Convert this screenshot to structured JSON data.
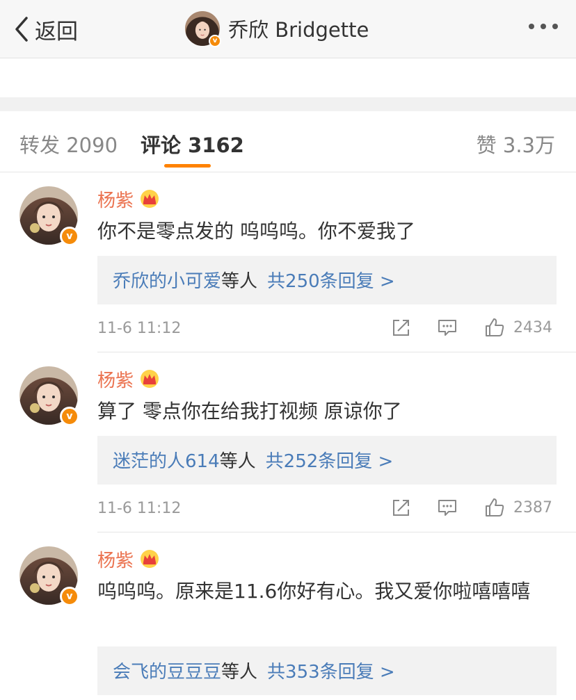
{
  "header": {
    "back_label": "返回",
    "title": "乔欣 Bridgette",
    "verified_mark": "v"
  },
  "tabs": {
    "repost": "转发 2090",
    "comment": "评论 3162",
    "like": "赞 3.3万"
  },
  "colors": {
    "accent": "#ff8200",
    "username": "#eb7350",
    "link": "#4a7cb8"
  },
  "comments": [
    {
      "user": "杨紫",
      "badge": "crown-icon",
      "text": "你不是零点发的 呜呜呜。你不爱我了",
      "reply_users": "乔欣的小可爱",
      "reply_mid": "等人",
      "reply_count": "共250条回复 >",
      "time": "11-6 11:12",
      "likes": "2434"
    },
    {
      "user": "杨紫",
      "badge": "crown-icon",
      "text": "算了 零点你在给我打视频 原谅你了",
      "reply_users": "迷茫的人614",
      "reply_mid": "等人",
      "reply_count": "共252条回复 >",
      "time": "11-6 11:12",
      "likes": "2387"
    },
    {
      "user": "杨紫",
      "badge": "crown-icon",
      "text": "呜呜呜。原来是11.6你好有心。我又爱你啦嘻嘻嘻",
      "reply_users": "会飞的豆豆豆",
      "reply_mid": "等人",
      "reply_count": "共353条回复 >",
      "time": "",
      "likes": ""
    }
  ]
}
